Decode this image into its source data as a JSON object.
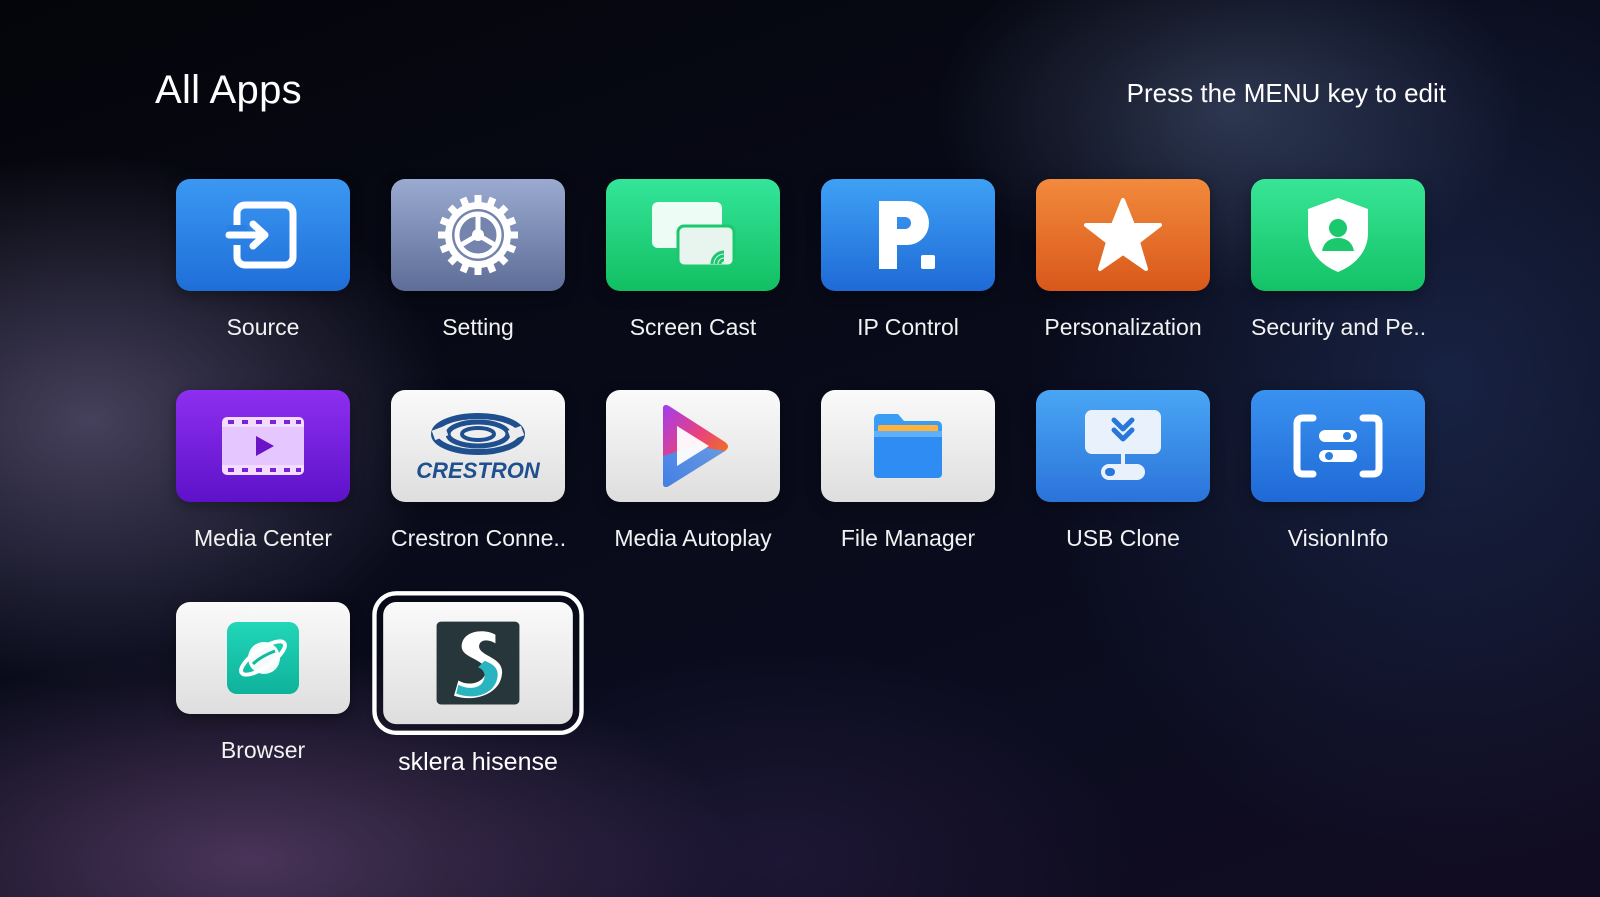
{
  "header": {
    "title": "All Apps",
    "hint": "Press the MENU key to edit"
  },
  "apps": [
    {
      "label": "Source",
      "icon": "source-input-icon",
      "color": "#2a84e8"
    },
    {
      "label": "Setting",
      "icon": "gear-icon",
      "color": "#7b8bb4"
    },
    {
      "label": "Screen Cast",
      "icon": "screen-cast-icon",
      "color": "#22d47d"
    },
    {
      "label": "IP Control",
      "icon": "ip-control-p-icon",
      "color": "#2a84e8"
    },
    {
      "label": "Personalization",
      "icon": "star-icon",
      "color": "#e56f2a"
    },
    {
      "label": "Security and Pe..",
      "icon": "shield-user-icon",
      "color": "#22d47d"
    },
    {
      "label": "Media Center",
      "icon": "film-play-icon",
      "color": "#7420dc"
    },
    {
      "label": "Crestron Conne..",
      "icon": "crestron-logo-icon",
      "color": "#ececec",
      "logo_text": "CRESTRON"
    },
    {
      "label": "Media Autoplay",
      "icon": "play-triangle-icon",
      "color": "#ececec"
    },
    {
      "label": "File Manager",
      "icon": "folder-icon",
      "color": "#ececec"
    },
    {
      "label": "USB Clone",
      "icon": "usb-download-icon",
      "color": "#388ce6"
    },
    {
      "label": "VisionInfo",
      "icon": "vision-info-icon",
      "color": "#2a7de3"
    },
    {
      "label": "Browser",
      "icon": "browser-planet-icon",
      "color": "#ececec"
    },
    {
      "label": "sklera hisense",
      "icon": "sklera-s-logo-icon",
      "color": "#ececec",
      "focused": true
    }
  ]
}
